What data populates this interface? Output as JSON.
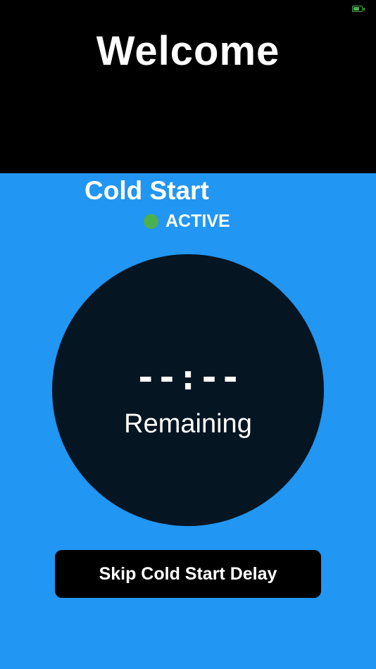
{
  "status_bar": {
    "battery_icon": "battery-charging-icon",
    "battery_level": 0.8,
    "battery_color": "#4CAF50"
  },
  "header": {
    "title": "Welcome",
    "background": "#000000"
  },
  "mode": {
    "title": "Cold Start",
    "status_label": "ACTIVE",
    "status_color": "#4CAF50"
  },
  "timer": {
    "value": "--:--",
    "label": "Remaining",
    "circle_color": "#061522"
  },
  "actions": {
    "skip_label": "Skip Cold Start Delay"
  },
  "colors": {
    "background": "#2196F3",
    "text": "#FFFFFF",
    "button": "#000000"
  }
}
